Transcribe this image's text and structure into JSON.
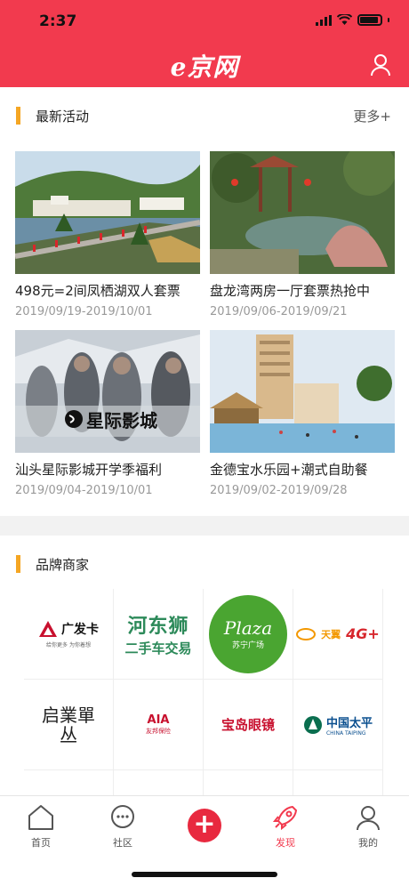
{
  "status_bar": {
    "time": "2:37"
  },
  "header": {
    "logo_text": "e京网",
    "brand_color": "#f23a4e"
  },
  "latest": {
    "title": "最新活动",
    "more": "更多+",
    "cards": [
      {
        "title": "498元=2间凤栖湖双人套票",
        "date": "2019/09/19-2019/10/01"
      },
      {
        "title": "盘龙湾两房一厅套票热抢中",
        "date": "2019/09/06-2019/09/21"
      },
      {
        "title": "汕头星际影城开学季福利",
        "date": "2019/09/04-2019/10/01",
        "image_text": "星际影城"
      },
      {
        "title": "金德宝水乐园+潮式自助餐",
        "date": "2019/09/02-2019/09/28"
      }
    ]
  },
  "brands": {
    "title": "品牌商家",
    "items": [
      {
        "name": "广发卡",
        "sub": "给你更多 为你着想"
      },
      {
        "name": "河东狮",
        "sub": "二手车交易"
      },
      {
        "name": "Plaza",
        "sub": "苏宁广场"
      },
      {
        "name": "天翼",
        "sub": "4G+"
      },
      {
        "name": "启業單丛",
        "sub": ""
      },
      {
        "name": "AIA",
        "sub": "友邦保险"
      },
      {
        "name": "宝岛眼镜",
        "sub": ""
      },
      {
        "name": "中国太平",
        "sub": "CHINA TAIPING"
      }
    ]
  },
  "tabbar": {
    "items": [
      {
        "label": "首页"
      },
      {
        "label": "社区"
      },
      {
        "label": "+"
      },
      {
        "label": "发现"
      },
      {
        "label": "我的"
      }
    ],
    "active_color": "#f23a4e"
  }
}
